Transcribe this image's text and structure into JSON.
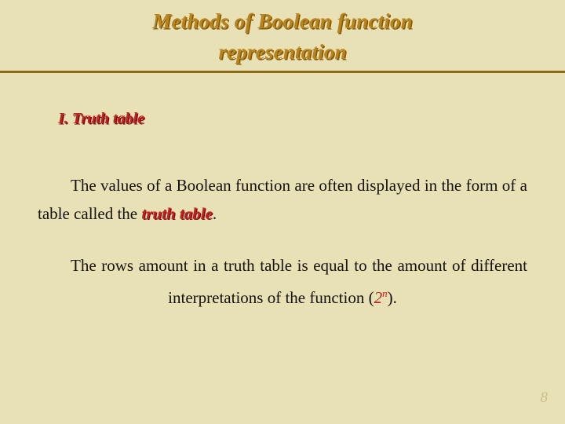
{
  "slide": {
    "title": {
      "line1": "Methods of Boolean function",
      "line2": "representation"
    },
    "section_heading": "I. Truth table",
    "paragraphs": [
      {
        "before": "The values of a Boolean function are often displayed in the form of a table called the ",
        "emphasis": "truth table",
        "after": "."
      },
      {
        "before": "The rows amount in a truth table is equal to the amount of different interpretations of the function (",
        "math_base": "2",
        "math_exponent": "n",
        "after": ")."
      }
    ],
    "page_number": "8",
    "colors": {
      "background": "#e8e1b6",
      "title": "#bc8418",
      "title_shadow": "#7d5a12",
      "divider": "#8a6a12",
      "accent_red": "#c42222",
      "accent_red_shadow": "#6e1414",
      "body_text": "#15100a",
      "page_number": "#c9bf8c"
    }
  }
}
